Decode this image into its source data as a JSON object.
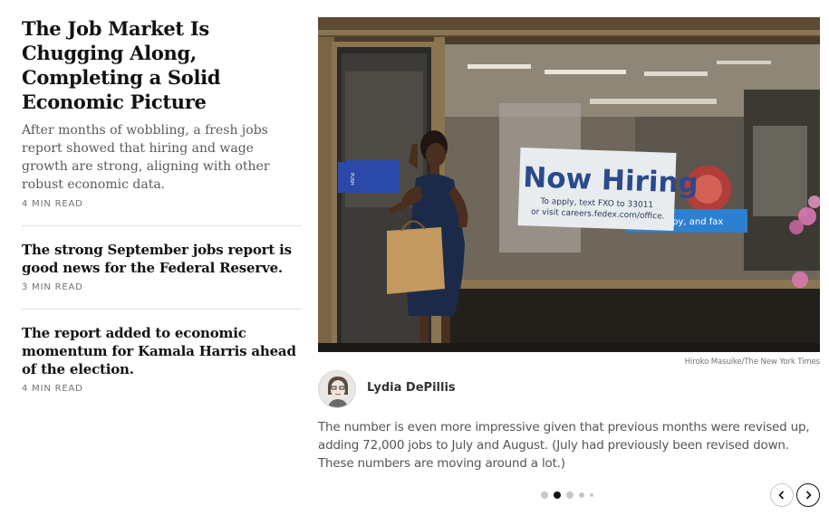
{
  "lead": {
    "headline": "The Job Market Is Chugging Along, Completing a Solid Economic Picture",
    "summary": "After months of wobbling, a fresh jobs report showed that hiring and wage growth are strong, aligning with other robust economic data.",
    "read_time": "4 MIN READ"
  },
  "related": [
    {
      "headline": "The strong September jobs report is good news for the Federal Reserve.",
      "read_time": "3 MIN READ"
    },
    {
      "headline": "The report added to economic momentum for Kamala Harris ahead of the election.",
      "read_time": "4 MIN READ"
    }
  ],
  "photo": {
    "sign_title": "Now Hiring",
    "sign_line1": "To apply, text FXO to 33011",
    "sign_line2": "or visit careers.fedex.com/office.",
    "banner_text": "scan, copy, and fax",
    "door_label": "PUSH",
    "credit": "Hiroko Masuike/The New York Times"
  },
  "byline": {
    "author": "Lydia DePillis",
    "text": "The number is even more impressive given that previous months were revised up, adding 72,000 jobs to July and August. (July had previously been revised down. These numbers are moving around a lot.)"
  },
  "carousel": {
    "active_index": 1,
    "dot_count": 5
  },
  "colors": {
    "accent_blue": "#1f5fa8",
    "text_primary": "#121212",
    "text_secondary": "#5a5a5a"
  }
}
